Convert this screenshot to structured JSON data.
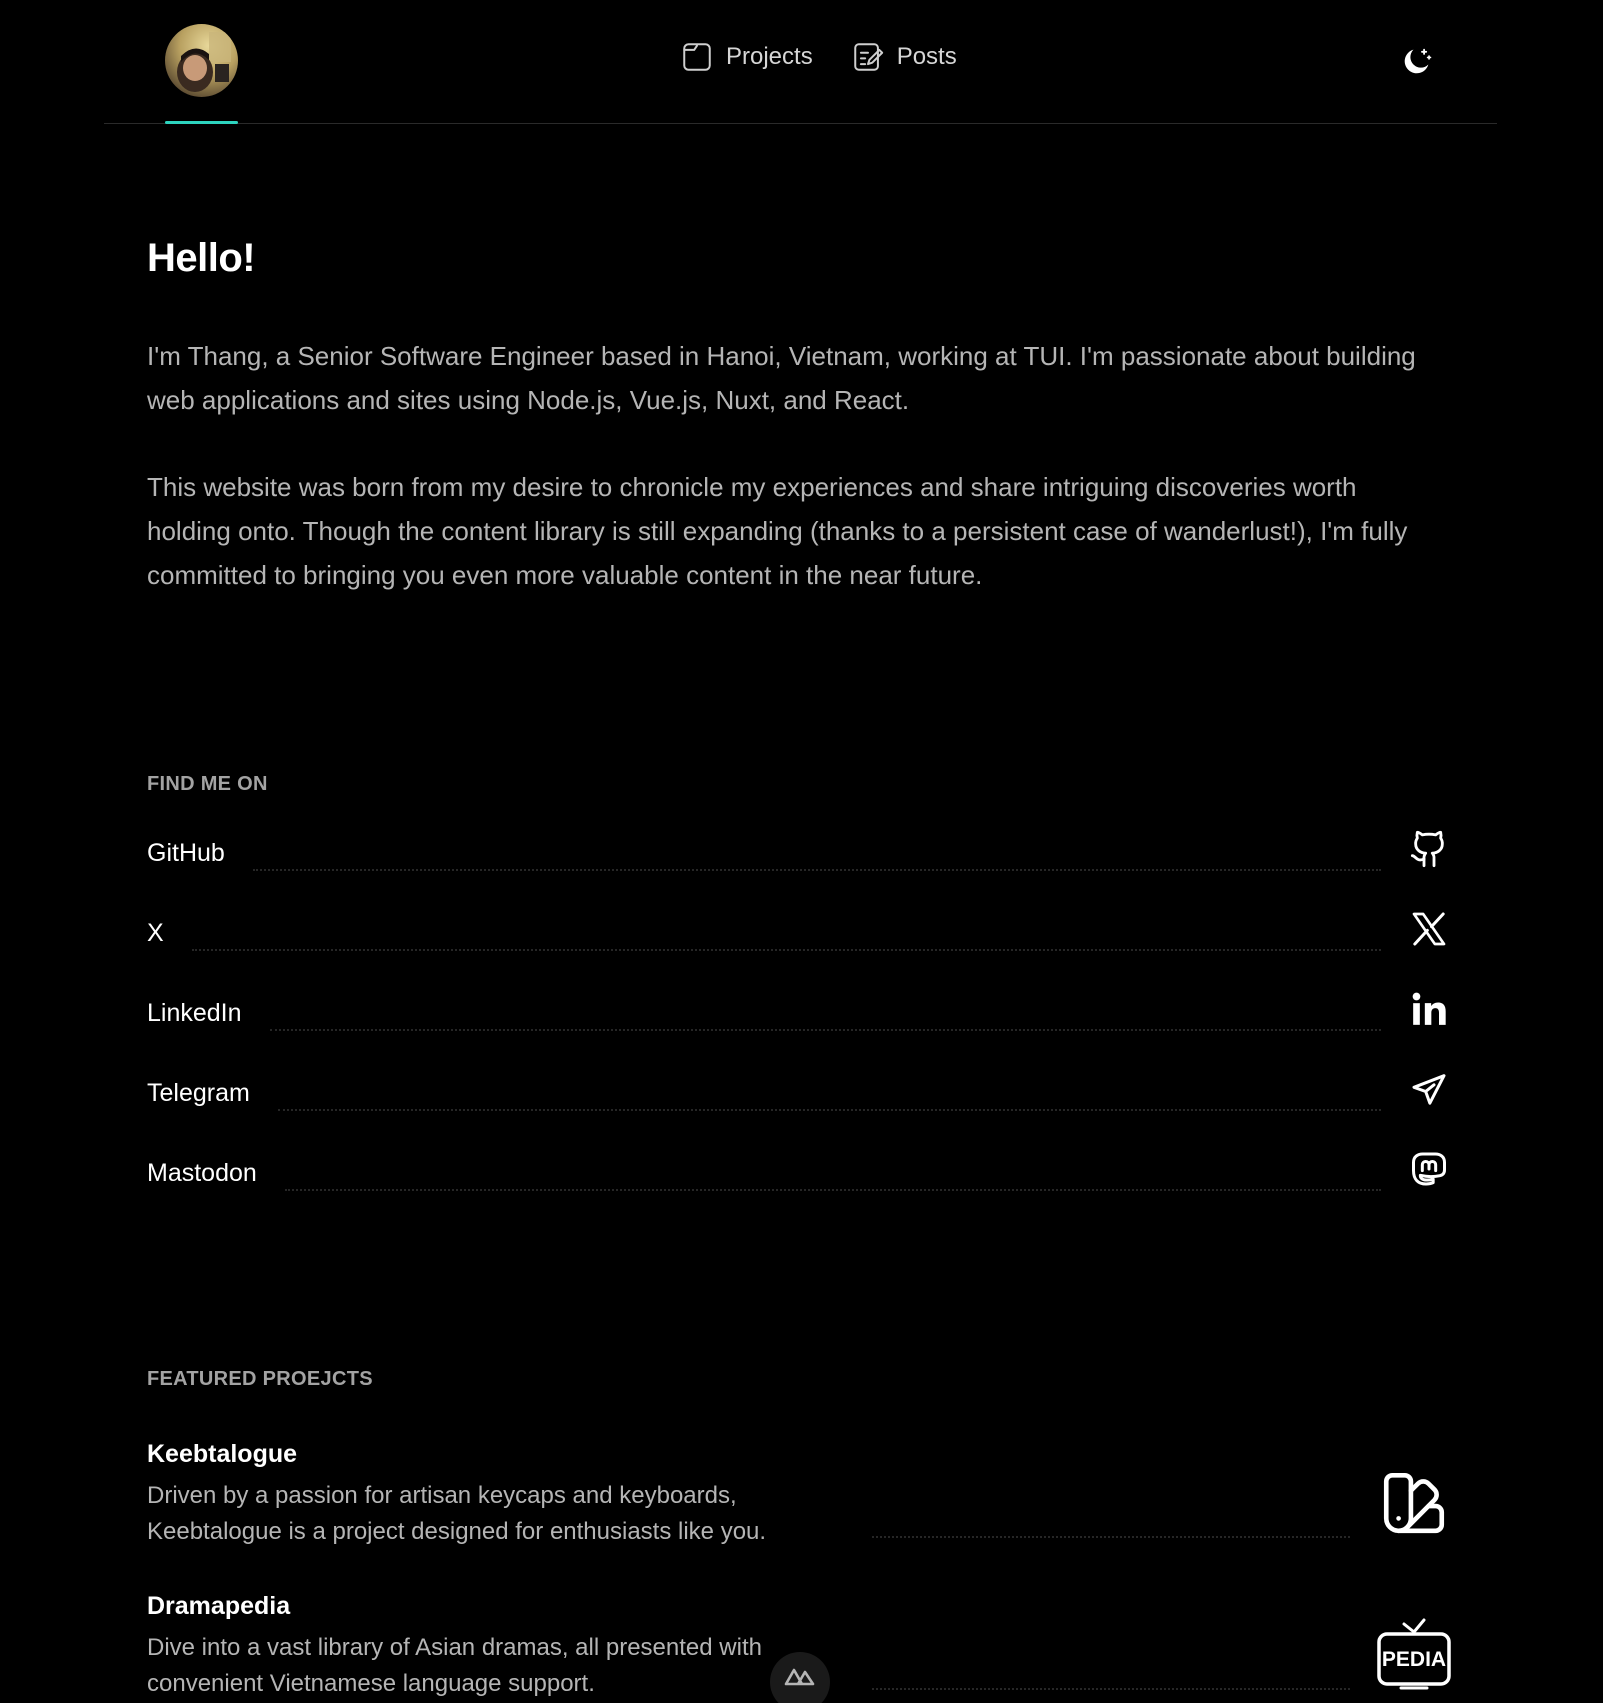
{
  "header": {
    "nav": [
      {
        "label": "Projects",
        "icon": "folder-icon"
      },
      {
        "label": "Posts",
        "icon": "edit-note-icon"
      }
    ],
    "theme_toggle_icon": "moon-icon",
    "accent_color": "#2dd4bf"
  },
  "intro": {
    "title": "Hello!",
    "paragraph1": "I'm Thang, a Senior Software Engineer based in Hanoi, Vietnam, working at TUI. I'm passionate about building web applications and sites using Node.js, Vue.js, Nuxt, and React.",
    "paragraph2": "This website was born from my desire to chronicle my experiences and share intriguing discoveries worth holding onto. Though the content library is still expanding (thanks to a persistent case of wanderlust!), I'm fully committed to bringing you even more valuable content in the near future."
  },
  "find_me": {
    "title": "FIND ME ON",
    "items": [
      {
        "label": "GitHub",
        "icon": "github-icon"
      },
      {
        "label": "X",
        "icon": "x-icon"
      },
      {
        "label": "LinkedIn",
        "icon": "linkedin-icon"
      },
      {
        "label": "Telegram",
        "icon": "telegram-icon"
      },
      {
        "label": "Mastodon",
        "icon": "mastodon-icon"
      }
    ]
  },
  "featured": {
    "title": "FEATURED PROEJCTS",
    "projects": [
      {
        "name": "Keebtalogue",
        "description": "Driven by a passion for artisan keycaps and keyboards, Keebtalogue is a project designed for enthusiasts like you.",
        "icon": "swatchbook-icon"
      },
      {
        "name": "Dramapedia",
        "description": "Dive into a vast library of Asian dramas, all presented with convenient Vietnamese language support.",
        "icon": "tv-pedia-icon",
        "icon_text": "PEDIA"
      }
    ]
  },
  "badge_icon": "nuxt-icon"
}
